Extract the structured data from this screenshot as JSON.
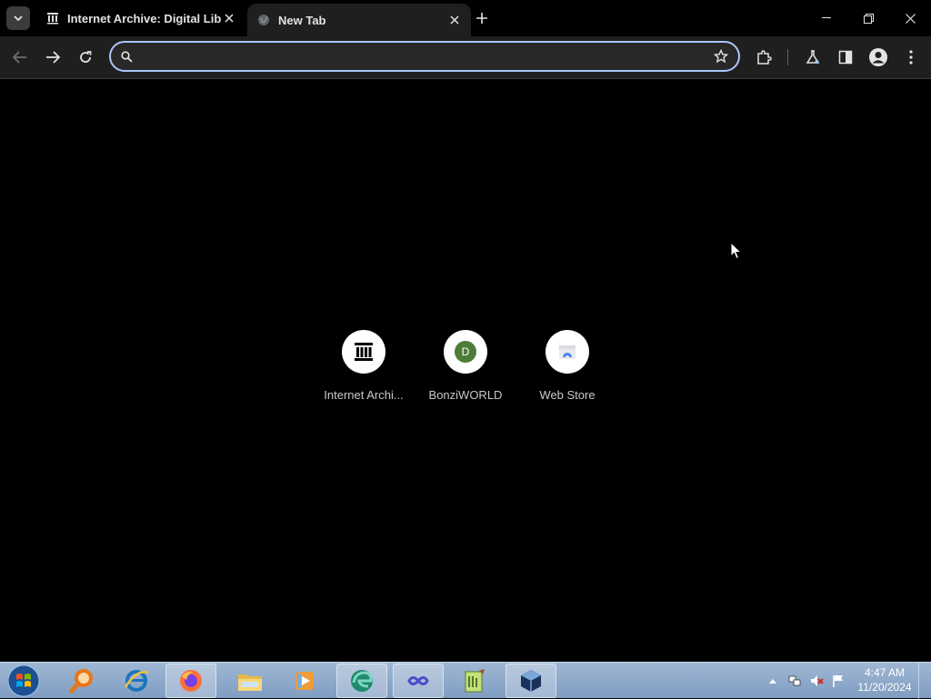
{
  "browser": {
    "tabs": [
      {
        "title": "Internet Archive: Digital Library",
        "favicon": "archive-icon"
      },
      {
        "title": "New Tab",
        "favicon": "globe-icon"
      }
    ],
    "omnibox": {
      "value": "",
      "placeholder": ""
    }
  },
  "shortcuts": [
    {
      "label": "Internet Archi...",
      "icon": "archive-icon"
    },
    {
      "label": "BonziWORLD",
      "icon": "letter-d-icon",
      "letter": "D",
      "color": "#4e7d3a"
    },
    {
      "label": "Web Store",
      "icon": "web-store-icon"
    }
  ],
  "taskbar": {
    "apps": [
      "search-app",
      "internet-explorer",
      "firefox",
      "file-explorer",
      "media-player",
      "edge",
      "visual-studio",
      "notepad-plus-plus",
      "virtualbox"
    ],
    "clock": {
      "time": "4:47 AM",
      "date": "11/20/2024"
    }
  },
  "colors": {
    "accent": "#a8c7fa",
    "toolbar": "#1f1f1f",
    "page": "#000000"
  }
}
